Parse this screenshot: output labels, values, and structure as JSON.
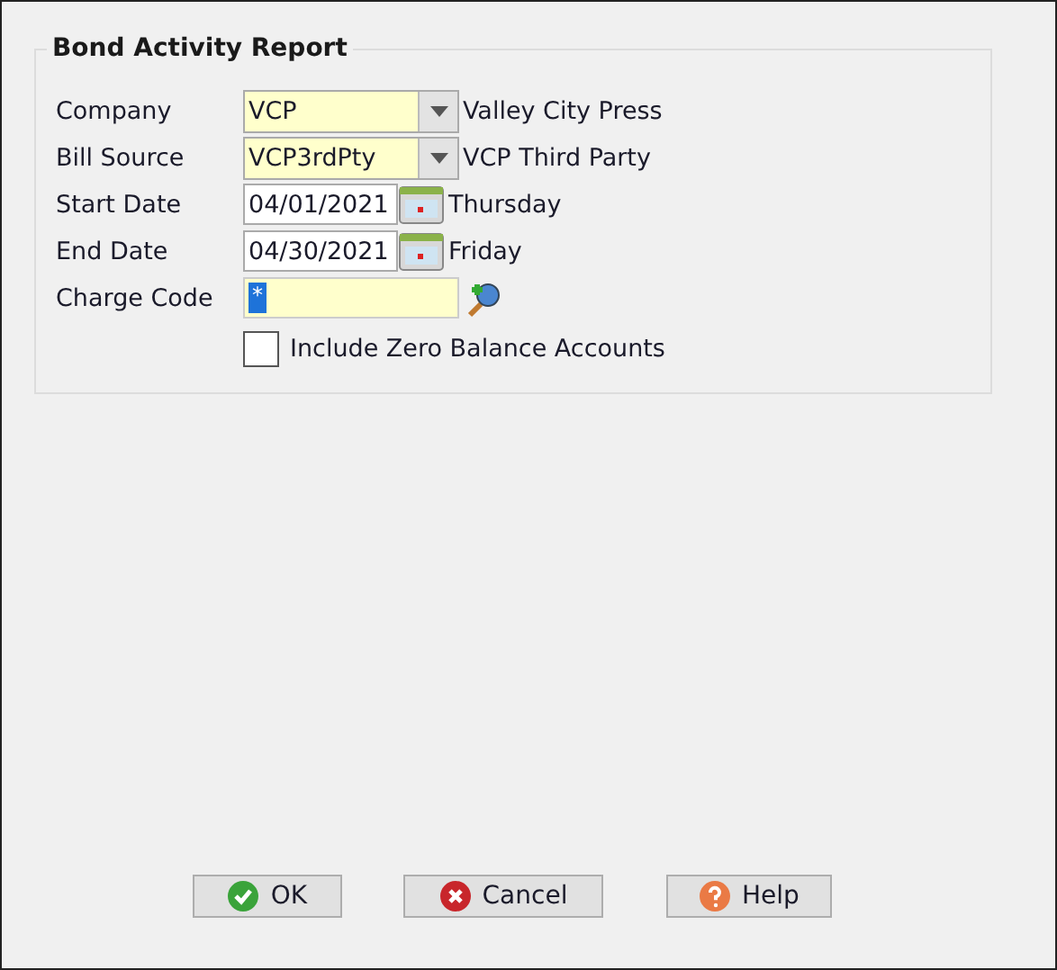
{
  "group": {
    "title": "Bond Activity Report"
  },
  "fields": [
    {
      "kind": "dropdown",
      "label": "Company",
      "value": "VCP",
      "description": "Valley City Press"
    },
    {
      "kind": "dropdown",
      "label": "Bill Source",
      "value": "VCP3rdPty",
      "description": "VCP Third Party"
    },
    {
      "kind": "date",
      "label": "Start Date",
      "value": "04/01/2021",
      "description": "Thursday"
    },
    {
      "kind": "date",
      "label": "End Date",
      "value": "04/30/2021",
      "description": "Friday"
    },
    {
      "kind": "lookup",
      "label": "Charge Code",
      "value": "*"
    },
    {
      "kind": "checkbox",
      "label": "Include Zero Balance Accounts",
      "checked": false
    }
  ],
  "buttons": [
    {
      "kind": "ok",
      "label": "OK"
    },
    {
      "kind": "cancel",
      "label": "Cancel"
    },
    {
      "kind": "help",
      "label": "Help"
    }
  ]
}
